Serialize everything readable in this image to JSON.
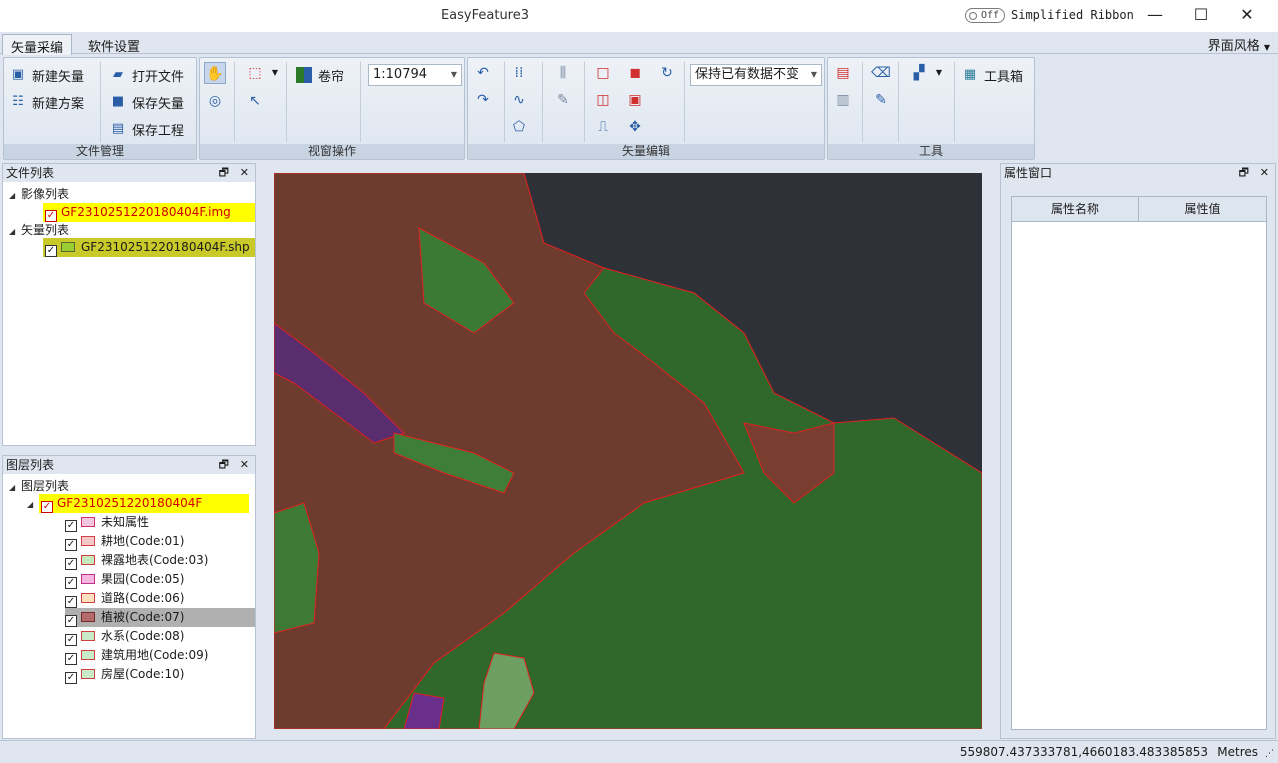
{
  "window": {
    "title": "EasyFeature3",
    "toggle_state": "Off",
    "simplified_ribbon_label": "Simplified Ribbon",
    "minimize": "—",
    "maximize": "☐",
    "close": "✕"
  },
  "tabs": {
    "items": [
      "矢量采编",
      "软件设置"
    ],
    "style_menu": "界面风格"
  },
  "ribbon": {
    "file": {
      "new_vector": "新建矢量",
      "new_plan": "新建方案",
      "open_file": "打开文件",
      "save_vector": "保存矢量",
      "save_project": "保存工程",
      "label": "文件管理"
    },
    "view": {
      "curtain": "卷帘",
      "scale": "1:10794",
      "label": "视窗操作"
    },
    "edit": {
      "keep_data": "保持已有数据不变",
      "label": "矢量编辑"
    },
    "tools": {
      "toolbox": "工具箱",
      "label": "工具"
    }
  },
  "file_panel": {
    "title": "文件列表",
    "image_group": "影像列表",
    "image_file": "GF2310251220180404F.img",
    "vector_group": "矢量列表",
    "vector_file": "GF2310251220180404F.shp"
  },
  "layer_panel": {
    "title": "图层列表",
    "root": "图层列表",
    "layer": "GF2310251220180404F",
    "classes": [
      {
        "label": "未知属性",
        "fill": "#f3c6df",
        "border": "#d0306a"
      },
      {
        "label": "耕地(Code:01)",
        "fill": "#f6c8c8",
        "border": "#d04040"
      },
      {
        "label": "裸露地表(Code:03)",
        "fill": "#c8e8c0",
        "border": "#d04040"
      },
      {
        "label": "果园(Code:05)",
        "fill": "#f4b8e0",
        "border": "#c0308a"
      },
      {
        "label": "道路(Code:06)",
        "fill": "#fbe0c0",
        "border": "#d04040"
      },
      {
        "label": "植被(Code:07)",
        "fill": "#b46a6a",
        "border": "#7a2b2b"
      },
      {
        "label": "水系(Code:08)",
        "fill": "#c8ecc8",
        "border": "#d04040"
      },
      {
        "label": "建筑用地(Code:09)",
        "fill": "#c8ecc8",
        "border": "#d04040"
      },
      {
        "label": "房屋(Code:10)",
        "fill": "#c8ecc8",
        "border": "#d04040"
      }
    ]
  },
  "attr_panel": {
    "title": "属性窗口",
    "col_name": "属性名称",
    "col_value": "属性值"
  },
  "status": {
    "coords": "559807.437333781,4660183.483385853",
    "units": "Metres"
  },
  "colors": {
    "accent": "#2a5fa8",
    "selection": "#ffff00",
    "map_brown": "#6b3a2e",
    "map_green": "#2f6a2a"
  }
}
